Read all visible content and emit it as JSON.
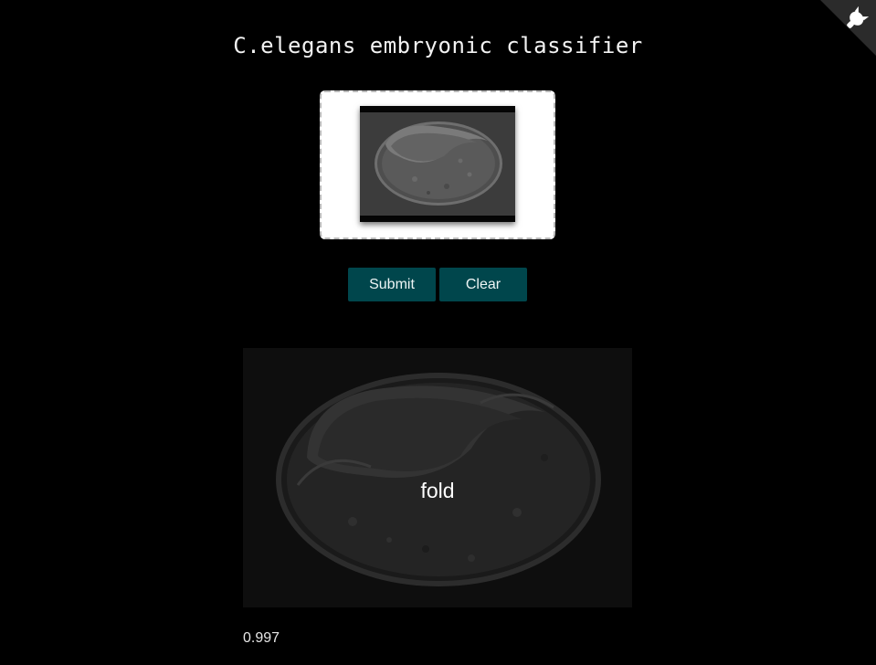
{
  "header": {
    "title": "C.elegans embryonic classifier",
    "corner_icon": "octocat-icon"
  },
  "upload": {
    "preview_image": "embryo-thumbnail"
  },
  "actions": {
    "submit_label": "Submit",
    "clear_label": "Clear"
  },
  "result": {
    "image": "embryo-image",
    "label": "fold",
    "score": "0.997"
  },
  "colors": {
    "background": "#000000",
    "button_bg": "#00464c",
    "text": "#ffffff"
  }
}
